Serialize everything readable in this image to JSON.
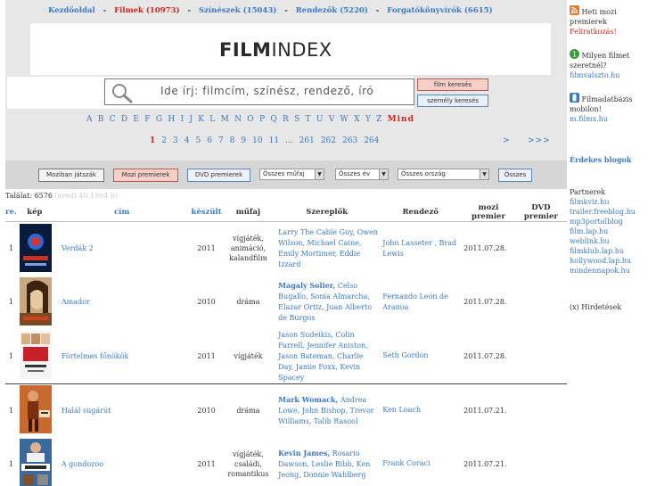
{
  "nav": {
    "home": "Kezdőoldal",
    "films": "Filmek",
    "films_count": "(10973)",
    "actors": "Színészek",
    "actors_count": "(15043)",
    "directors": "Rendezők",
    "directors_count": "(5220)",
    "writers": "Forgatókönyvírók",
    "writers_count": "(6615)",
    "separator": "-"
  },
  "logo": {
    "bold": "FILM",
    "light": "INDEX"
  },
  "search": {
    "placeholder": "Ide írj: filmcím, színész, rendező, író",
    "film_button": "film keresés",
    "person_button": "személy keresés"
  },
  "alphabet": {
    "letters": [
      "A",
      "B",
      "C",
      "D",
      "E",
      "F",
      "G",
      "H",
      "I",
      "J",
      "K",
      "L",
      "M",
      "N",
      "O",
      "P",
      "Q",
      "R",
      "S",
      "T",
      "U",
      "V",
      "W",
      "X",
      "Y",
      "Z"
    ],
    "all": "Mind"
  },
  "pagination": {
    "pages": [
      "1",
      "2",
      "3",
      "4",
      "5",
      "6",
      "7",
      "8",
      "9",
      "10",
      "11",
      "...",
      "261",
      "262",
      "263",
      "264"
    ],
    "current": "1",
    "next": ">",
    "last": ">>>"
  },
  "filters": {
    "in_cinemas": "Moziban játszák",
    "premieres": "Mozi premierek",
    "dvd": "DVD premierek",
    "genre": "Összes műfaj",
    "year": "Összes év",
    "country": "Összes ország",
    "all": "Összes"
  },
  "found": {
    "label": "Találat: 6576",
    "muted": "(eredi 40 1964 b)"
  },
  "table": {
    "headers": {
      "rank": "re.",
      "image": "kép",
      "title": "cím",
      "year": "készült",
      "genre": "műfaj",
      "cast": "Szereplők",
      "director": "Rendező",
      "cinema_premiere": "mozi premier",
      "dvd_premiere": "DVD premier"
    },
    "rows": [
      {
        "rank": "1",
        "title": "Verdák 2",
        "year": "2011",
        "genre": [
          "vígjáték,",
          "animáció,",
          "kalandfilm"
        ],
        "cast_bold": "",
        "cast": "Larry The Cable Guy, Owen Wilson, Michael Caine, Emily Mortimer, Eddie Izzard",
        "director": "John Lasseter , Brad Lewis",
        "cinema_premiere": "2011.07.28.",
        "dvd_premiere": ""
      },
      {
        "rank": "1",
        "title": "Amador",
        "year": "2010",
        "genre": [
          "dráma"
        ],
        "cast_bold": "Magaly Solier,",
        "cast": "Celso Bugallo, Sonia Almarcha, Elazar Ortiz, Juan Alberto de Burgos",
        "director": "Fernando León de Aranoa",
        "cinema_premiere": "2011.07.28.",
        "dvd_premiere": ""
      },
      {
        "rank": "1",
        "title": "Förtelmes főnökök",
        "year": "2011",
        "genre": [
          "vígjáték"
        ],
        "cast_bold": "",
        "cast": "Jason Sudeikis, Colin Farrell, Jennifer Aniston, Jason Bateman, Charlie Day, Jamie Foxx, Kevin Spacey",
        "director": "Seth Gordon",
        "cinema_premiere": "2011.07.28.",
        "dvd_premiere": ""
      },
      {
        "rank": "1",
        "title": "Halál sugárút",
        "year": "2010",
        "genre": [
          "dráma"
        ],
        "cast_bold": "Mark Womack,",
        "cast": "Andrea Lowe, John Bishop, Trevor Williams, Talib Rasool",
        "director": "Ken Loach",
        "cinema_premiere": "2011.07.21.",
        "dvd_premiere": ""
      },
      {
        "rank": "1",
        "title": "A gondozoo",
        "year": "2011",
        "genre": [
          "vígjáték, családi,",
          "romantikus"
        ],
        "cast_bold": "Kevin James,",
        "cast": "Rosario Dawson, Leslie Bibb, Ken Jeong, Donnie Wahlberg",
        "director": "Frank Coraci",
        "cinema_premiere": "2011.07.21.",
        "dvd_premiere": ""
      }
    ]
  },
  "sidebar": {
    "rss_text": "Heti mozi premierek",
    "rss_link": "Feliratkozás!",
    "poll_text": "Milyen filmet szeretnél?",
    "poll_link": "filmvalszto.hu",
    "mobile_text": "Filmadatbázis mobilon!",
    "mobile_link": "m.filmx.hu",
    "blogs_heading": "Érdekes blogok",
    "partners_label": "Partnerek",
    "partners": [
      "filmkviz.hu",
      "trailer.freeblog.hu",
      "mp3portalblog",
      "film.lap.hu",
      "weblink.hu",
      "filmklub.lap.hu",
      "hollywood.lap.hu",
      "mindennapok.hu"
    ],
    "ads": "(x) Hirdetések"
  }
}
